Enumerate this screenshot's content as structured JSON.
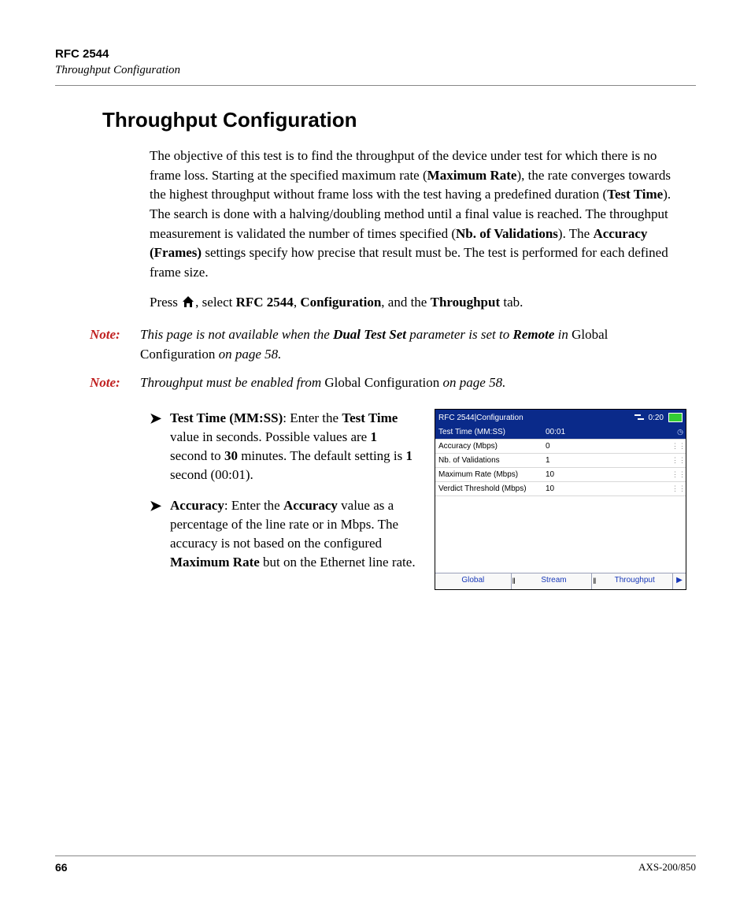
{
  "header": {
    "chapter": "RFC 2544",
    "section": "Throughput Configuration"
  },
  "title": "Throughput Configuration",
  "para1": {
    "t1": "The objective of this test is to find the throughput of the device under test for which there is no frame loss. Starting at the specified maximum rate (",
    "b1": "Maximum Rate",
    "t2": "), the rate converges towards the highest throughput without frame loss with the test having a predefined duration (",
    "b2": "Test Time",
    "t3": "). The search is done with a halving/doubling method until a final value is reached. The throughput measurement is validated the number of times specified (",
    "b3": "Nb. of Validations",
    "t4": "). The ",
    "b4": "Accuracy (Frames)",
    "t5": " settings specify how precise that result must be. The test is performed for each defined frame size."
  },
  "para2": {
    "t1": "Press ",
    "t2": ", select ",
    "b1": "RFC 2544",
    "t3": ", ",
    "b2": "Configuration",
    "t4": ", and the ",
    "b3": "Throughput",
    "t5": " tab."
  },
  "note_label": "Note:",
  "note1": {
    "t1": "This page is not available when the ",
    "b1": "Dual Test Set",
    "t2": " parameter is set to ",
    "b2": "Remote",
    "t3": " in ",
    "u1": "Global Configuration",
    "t4": " on page 58."
  },
  "note2": {
    "t1": "Throughput must be enabled from ",
    "u1": "Global Configuration",
    "t2": " on page 58."
  },
  "bullet_arrow": "➤",
  "bullet1": {
    "b1": "Test Time (MM:SS)",
    "t1": ": Enter the ",
    "b2": "Test Time",
    "t2": " value in seconds. Possible values are ",
    "b3": "1",
    "t3": " second to ",
    "b4": "30",
    "t4": " minutes. The default setting is ",
    "b5": "1",
    "t5": " second (00:01)."
  },
  "bullet2": {
    "b1": "Accuracy",
    "t1": ": Enter the ",
    "b2": "Accuracy",
    "t2": " value as a percentage of the line rate or in Mbps. The accuracy is not based on the configured ",
    "b3": "Maximum Rate",
    "t3": " but on the Ethernet line rate."
  },
  "device": {
    "title": "RFC 2544|Configuration",
    "clock": "0:20",
    "rows": [
      {
        "label": "Test Time (MM:SS)",
        "value": "00:01",
        "selected": true,
        "grip": "◷"
      },
      {
        "label": "Accuracy (Mbps)",
        "value": "0",
        "selected": false,
        "grip": "⋮⋮"
      },
      {
        "label": "Nb. of Validations",
        "value": "1",
        "selected": false,
        "grip": "⋮⋮"
      },
      {
        "label": "Maximum Rate (Mbps)",
        "value": "10",
        "selected": false,
        "grip": "⋮⋮"
      },
      {
        "label": "Verdict Threshold (Mbps)",
        "value": "10",
        "selected": false,
        "grip": "⋮⋮"
      }
    ],
    "tabs": [
      "Global",
      "Stream",
      "Throughput"
    ],
    "scroll": "▶"
  },
  "footer": {
    "page": "66",
    "model": "AXS-200/850"
  }
}
